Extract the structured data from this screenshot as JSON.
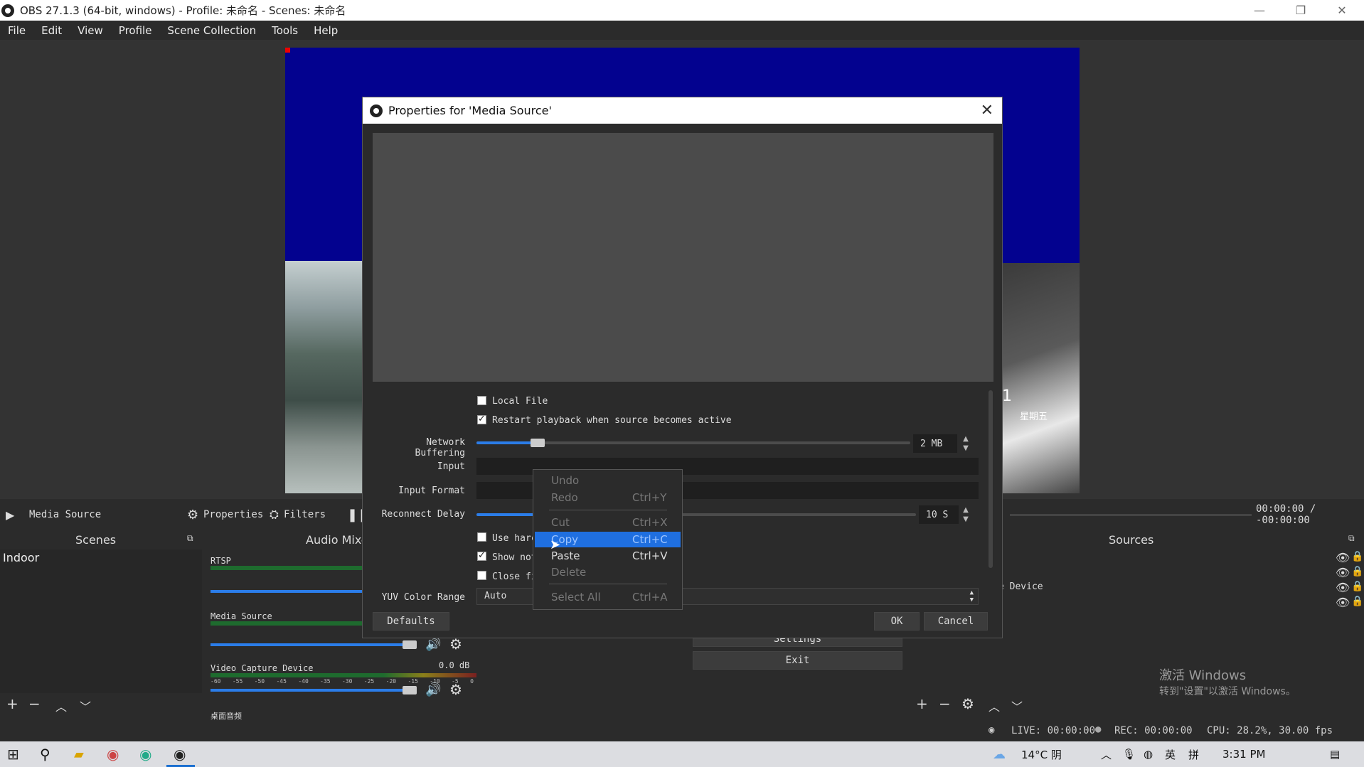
{
  "window": {
    "title": "OBS 27.1.3 (64-bit, windows) - Profile: 未命名 - Scenes: 未命名"
  },
  "menu": [
    "File",
    "Edit",
    "View",
    "Profile",
    "Scene Collection",
    "Tools",
    "Help"
  ],
  "preview": {
    "overlay_text_small": "星期五",
    "overlay_text_big": "1"
  },
  "controls_bar": {
    "source_name": "Media Source",
    "properties_label": "Properties",
    "filters_label": "Filters",
    "time": "00:00:00 / -00:00:00"
  },
  "docks": {
    "scenes_title": "Scenes",
    "audio_title": "Audio Mixer",
    "sources_title": "Sources",
    "scenes": [
      "Indoor"
    ],
    "sources_partial": "e Device",
    "audio_channels": [
      {
        "name": "RTSP",
        "db": ""
      },
      {
        "name": "Media Source",
        "db": ""
      },
      {
        "name": "Video Capture Device",
        "db": "0.0 dB"
      }
    ],
    "meter_ticks": [
      "-60",
      "-55",
      "-50",
      "-45",
      "-40",
      "-35",
      "-30",
      "-25",
      "-20",
      "-15",
      "-10",
      "-5",
      "0"
    ],
    "audio_partial_next": "桌面音频",
    "controls_buttons": {
      "settings": "Settings",
      "exit": "Exit"
    }
  },
  "status": {
    "live": "LIVE: 00:00:00",
    "rec": "REC: 00:00:00",
    "cpu": "CPU: 28.2%, 30.00 fps"
  },
  "watermark": {
    "line1": "激活 Windows",
    "line2": "转到\"设置\"以激活 Windows。"
  },
  "dialog": {
    "title": "Properties for 'Media Source'",
    "local_file": "Local File",
    "restart_playback": "Restart playback when source becomes active",
    "network_buffering_label": "Network Buffering",
    "network_buffering_value": "2 MB",
    "network_buffering_fraction": 0.14,
    "input_label": "Input",
    "input_format_label": "Input Format",
    "reconnect_delay_label": "Reconnect Delay",
    "reconnect_delay_value": "10 S",
    "use_hardware_partial": "Use harc",
    "show_nothing_partial": "Show not",
    "close_file_partial": "Close fi",
    "yuv_label": "YUV Color Range",
    "yuv_value": "Auto",
    "defaults_label": "Defaults",
    "ok_label": "OK",
    "cancel_label": "Cancel"
  },
  "context_menu": {
    "items": [
      {
        "label": "Undo",
        "shortcut": "",
        "disabled": true
      },
      {
        "label": "Redo",
        "shortcut": "Ctrl+Y",
        "disabled": true
      },
      {
        "label": "Cut",
        "shortcut": "Ctrl+X",
        "disabled": true
      },
      {
        "label": "Copy",
        "shortcut": "Ctrl+C",
        "disabled": true,
        "highlighted": true
      },
      {
        "label": "Paste",
        "shortcut": "Ctrl+V",
        "disabled": false
      },
      {
        "label": "Delete",
        "shortcut": "",
        "disabled": true
      },
      {
        "label": "Select All",
        "shortcut": "Ctrl+A",
        "disabled": true
      }
    ]
  },
  "taskbar": {
    "weather": "14°C 阴",
    "ime1": "英",
    "ime2": "拼",
    "time": "3:31 PM"
  }
}
